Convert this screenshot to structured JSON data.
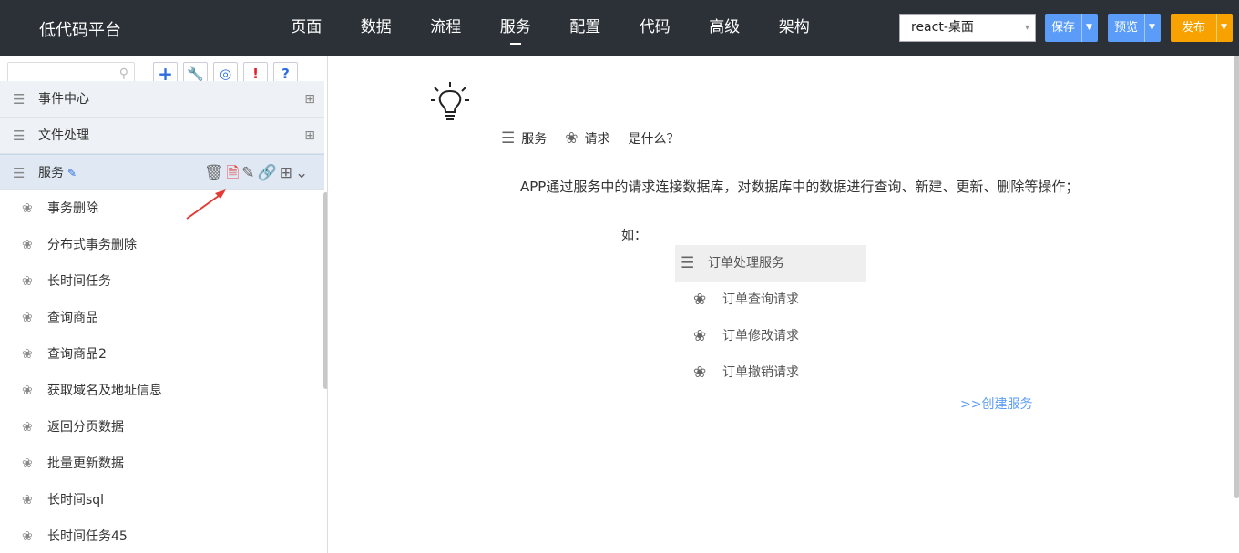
{
  "header": {
    "logo": "低代码平台",
    "nav": [
      "页面",
      "数据",
      "流程",
      "服务",
      "配置",
      "代码",
      "高级",
      "架构"
    ],
    "active_nav": "服务",
    "platform_select": "react-桌面",
    "save_label": "保存",
    "preview_label": "预览",
    "publish_label": "发布"
  },
  "sidebar": {
    "search_placeholder": "",
    "groups": [
      {
        "label": "事件中心"
      },
      {
        "label": "文件处理"
      },
      {
        "label": "服务"
      }
    ],
    "items": [
      {
        "label": "事务删除"
      },
      {
        "label": "分布式事务删除"
      },
      {
        "label": "长时间任务"
      },
      {
        "label": "查询商品"
      },
      {
        "label": "查询商品2"
      },
      {
        "label": "获取域名及地址信息"
      },
      {
        "label": "返回分页数据"
      },
      {
        "label": "批量更新数据"
      },
      {
        "label": "长时间sql"
      },
      {
        "label": "长时间任务45"
      }
    ]
  },
  "main": {
    "q_service": "服务",
    "q_request": "请求",
    "q_what": "是什么？",
    "description": "APP通过服务中的请求连接数据库，对数据库中的数据进行查询、新建、更新、删除等操作；",
    "example_label": "如：",
    "example_service": "订单处理服务",
    "example_requests": [
      "订单查询请求",
      "订单修改请求",
      "订单撤销请求"
    ],
    "create_link": ">>创建服务"
  },
  "colors": {
    "header_bg": "#2c3138",
    "primary": "#5a9cf8",
    "publish": "#f7a200",
    "danger": "#e0232e"
  }
}
